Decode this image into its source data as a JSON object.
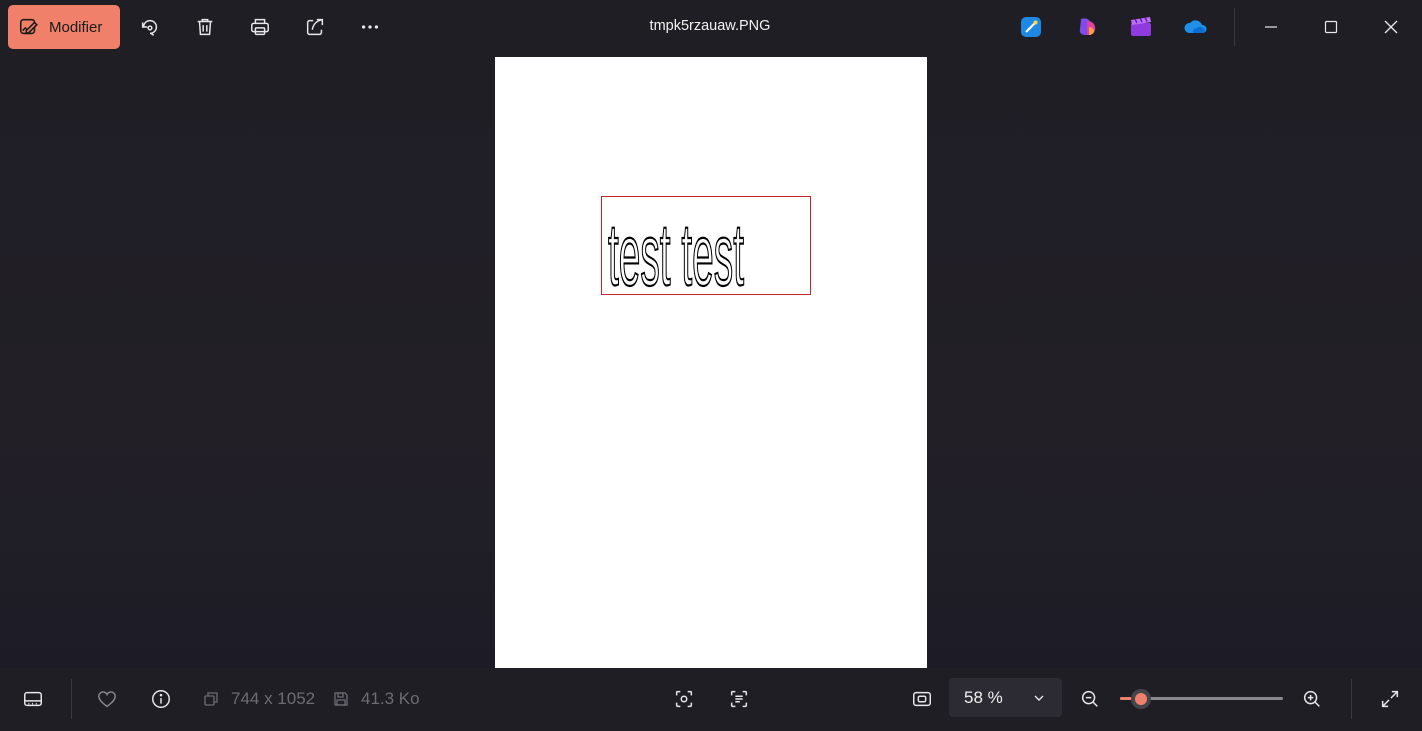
{
  "toolbar": {
    "edit_label": "Modifier",
    "icons": [
      "rotate-icon",
      "delete-icon",
      "print-icon",
      "share-icon",
      "more-icon"
    ]
  },
  "window": {
    "title": "tmpk5rzauaw.PNG",
    "apps": [
      "designer-icon",
      "copilot-icon",
      "clipchamp-icon",
      "onedrive-icon"
    ],
    "controls": [
      "minimize-icon",
      "maximize-icon",
      "close-icon"
    ]
  },
  "document": {
    "text": "test test",
    "box_color": "#c8242c"
  },
  "statusbar": {
    "dimensions": "744 x 1052",
    "file_size": "41.3 Ko",
    "zoom_label": "58 %",
    "zoom_slider_fraction": 0.13
  },
  "colors": {
    "accent": "#f0806a",
    "background": "#202028",
    "bar": "#1f1e25"
  }
}
